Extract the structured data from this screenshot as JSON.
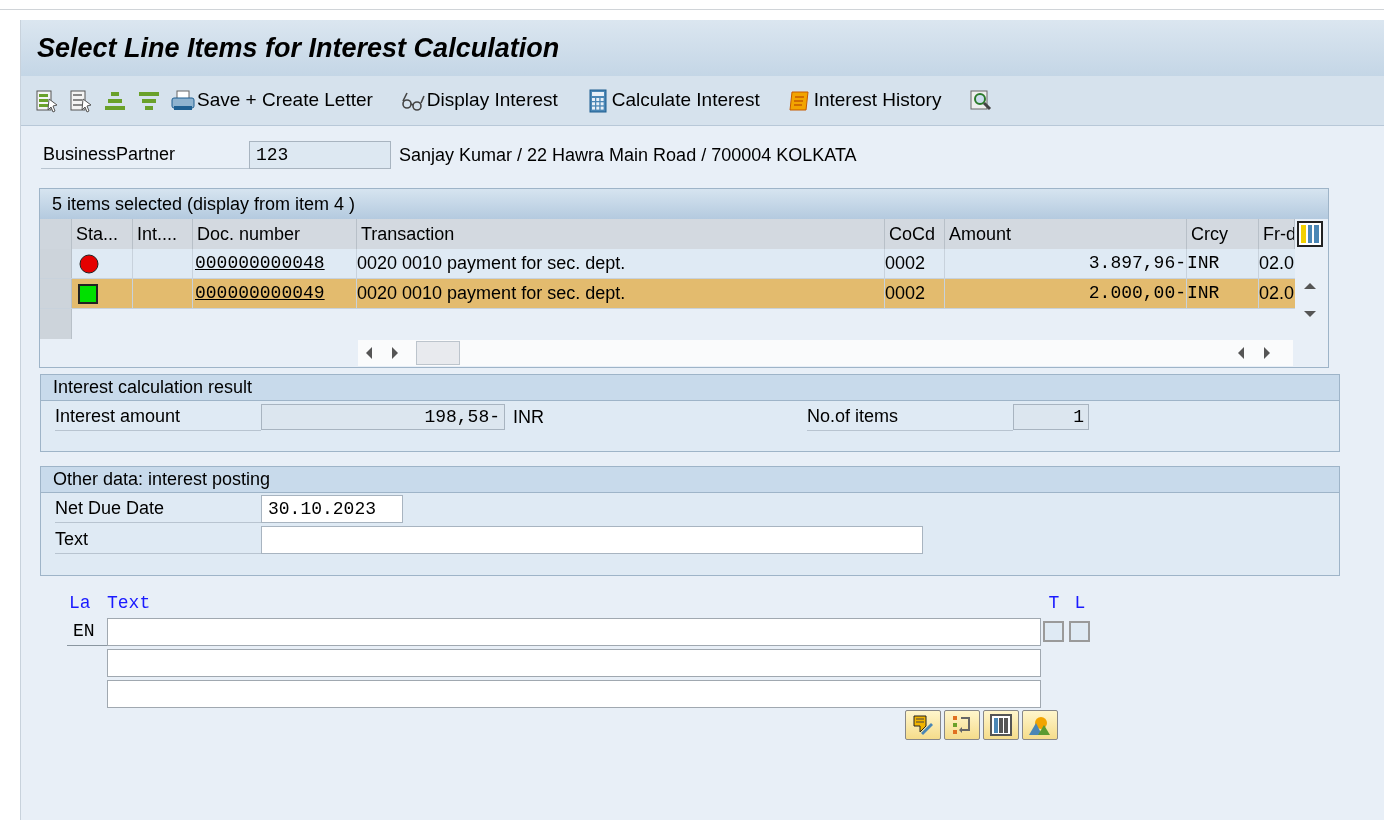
{
  "window": {
    "title": "Select Line Items for Interest Calculation"
  },
  "toolbar": [
    {
      "kind": "select-all"
    },
    {
      "kind": "deselect"
    },
    {
      "kind": "sort-up"
    },
    {
      "kind": "filter"
    },
    {
      "kind": "print",
      "label": "Save + Create Letter"
    },
    {
      "kind": "glasses",
      "label": "Display Interest"
    },
    {
      "kind": "calculator",
      "label": "Calculate Interest"
    },
    {
      "kind": "scroll",
      "label": "Interest History"
    },
    {
      "kind": "magnifier"
    }
  ],
  "business_partner": {
    "label": "BusinessPartner",
    "value": "123",
    "description": "Sanjay Kumar / 22 Hawra Main Road / 700004 KOLKATA"
  },
  "table": {
    "title": "5 items selected (display from item 4 )",
    "columns": [
      "Sta...",
      "Int....",
      "Doc. number",
      "Transaction",
      "CoCd",
      "Amount",
      "Crcy",
      "Fr-d"
    ],
    "rows": [
      {
        "kind": "red-light",
        "doc_number": "000000000048",
        "transaction": "0020 0010 payment for sec. dept.",
        "cocd": "0002",
        "amount": "3.897,96-",
        "crcy": "INR",
        "fr_d": "02.0",
        "selected": false
      },
      {
        "kind": "green-square",
        "doc_number": "000000000049",
        "transaction": "0020 0010 payment for sec. dept.",
        "cocd": "0002",
        "amount": "2.000,00-",
        "crcy": "INR",
        "fr_d": "02.0",
        "selected": true
      }
    ]
  },
  "result": {
    "title": "Interest calculation result",
    "interest_amount_label": "Interest amount",
    "interest_amount": "198,58-",
    "currency": "INR",
    "items_label": "No.of items",
    "items": "1"
  },
  "posting": {
    "title": "Other data: interest posting",
    "due_label": "Net Due Date",
    "due": "30.10.2023",
    "text_label": "Text"
  },
  "long_text": {
    "columns": [
      "La",
      "Text",
      "T",
      "L"
    ],
    "language": "EN",
    "t_checked": false,
    "l_checked": false
  },
  "bottom_buttons": [
    {
      "kind": "edit"
    },
    {
      "kind": "transfer"
    },
    {
      "kind": "columns"
    },
    {
      "kind": "image"
    }
  ]
}
